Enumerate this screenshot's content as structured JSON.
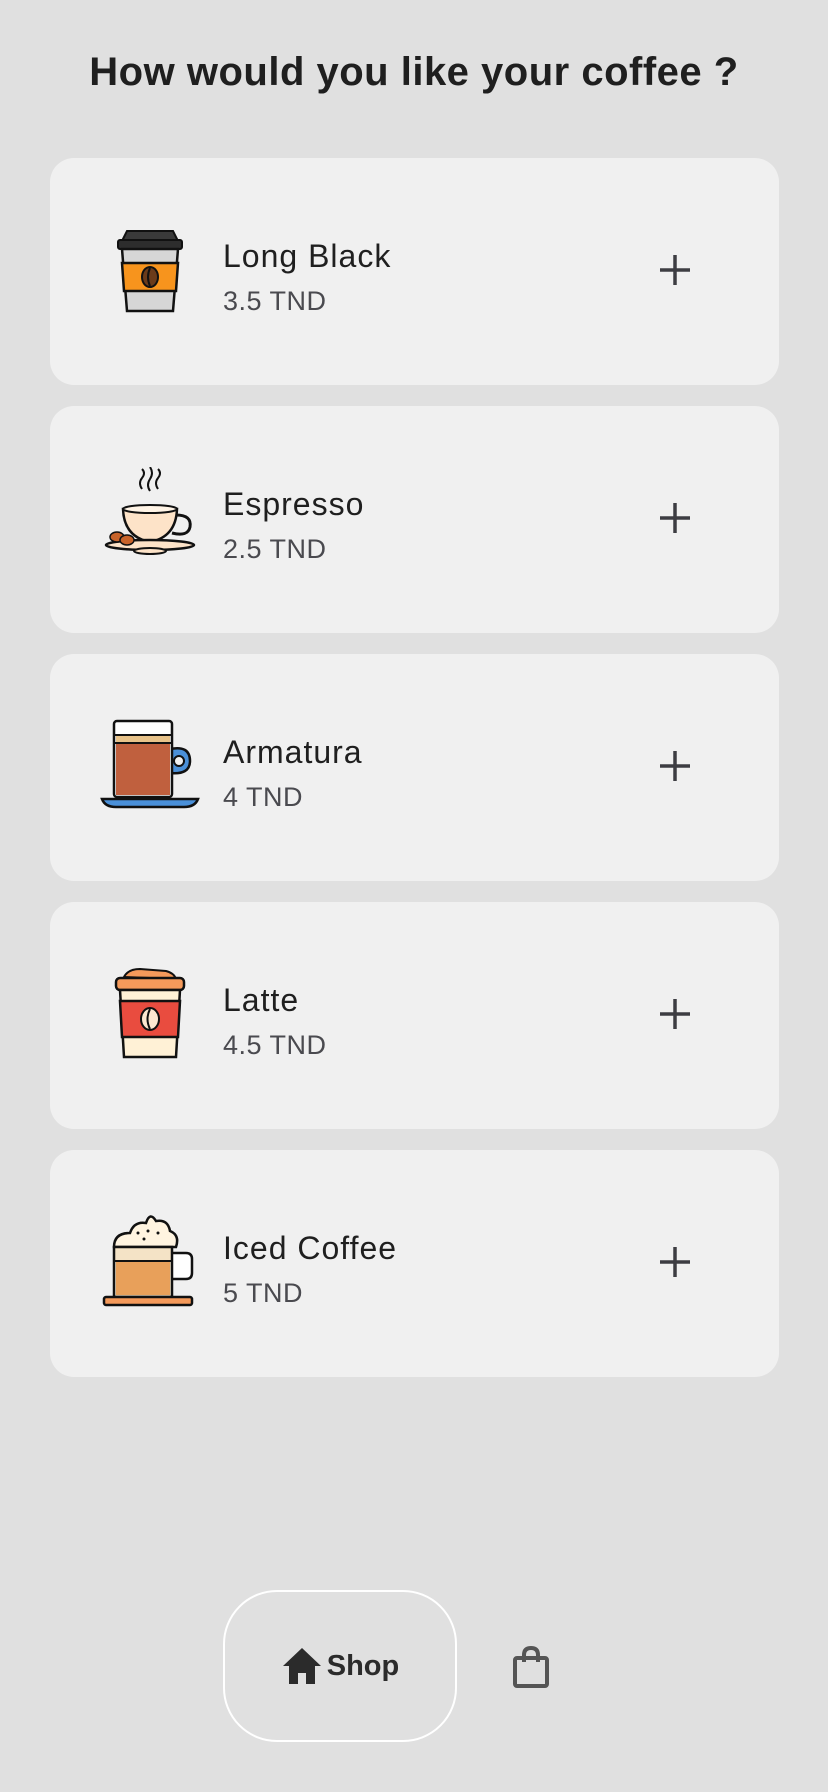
{
  "page_title": "How would you like your coffee ?",
  "products": [
    {
      "name": "Long Black",
      "price": "3.5 TND",
      "icon": "takeaway-cup-orange-icon"
    },
    {
      "name": "Espresso",
      "price": "2.5 TND",
      "icon": "espresso-cup-icon"
    },
    {
      "name": "Armatura",
      "price": "4 TND",
      "icon": "glass-mug-icon"
    },
    {
      "name": "Latte",
      "price": "4.5 TND",
      "icon": "takeaway-cup-red-icon"
    },
    {
      "name": "Iced Coffee",
      "price": "5 TND",
      "icon": "cream-mug-icon"
    }
  ],
  "nav": {
    "shop_label": "Shop",
    "shop_icon": "home-icon",
    "bag_icon": "shopping-bag-icon"
  },
  "colors": {
    "background": "#e0e0e0",
    "card": "#f0f0f0",
    "text": "#1f1f1f",
    "price_text": "#4a4a4f"
  }
}
